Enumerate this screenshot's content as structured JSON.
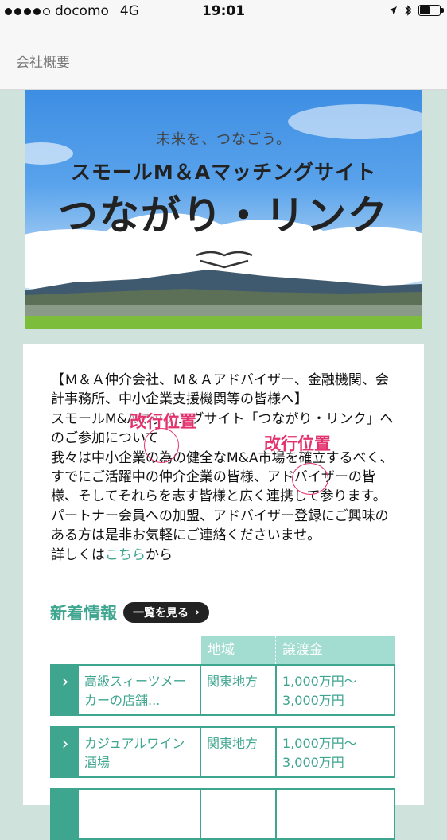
{
  "status_bar": {
    "carrier": "docomo",
    "network": "4G",
    "time": "19:01"
  },
  "header": {
    "title": "会社概要"
  },
  "banner": {
    "tagline": "未来を、つなごう。",
    "subtitle": "スモールM＆Aマッチングサイト",
    "brand": "つながり・リンク"
  },
  "intro": {
    "line1": "【Ｍ＆Ａ仲介会社、Ｍ＆Ａアドバイザー、金融機関、会計事務所、中小企業支援機関等の皆様へ】",
    "line2": "スモールM&Aマッチングサイト「つながり・リンク」へのご参加について",
    "line3": "我々は中小企業の為の健全なM&A市場を確立するべく、すでにご活躍中の仲介企業の皆様、アドバイザーの皆様、そしてそれらを志す皆様と広く連携して参ります。",
    "line4": "パートナー会員への加盟、アドバイザー登録にご興味のある方は是非お気軽にご連絡くださいませ。",
    "more_prefix": "詳しくは",
    "more_link": "こちら",
    "more_suffix": "から"
  },
  "annotations": {
    "label_1": "改行位置",
    "label_2": "改行位置"
  },
  "news": {
    "title": "新着情報",
    "see_all": "一覧を見る",
    "columns": {
      "region": "地域",
      "price": "譲渡金"
    },
    "rows": [
      {
        "name": "高級スィーツメーカーの店舗...",
        "region": "関東地方",
        "price": "1,000万円〜3,000万円"
      },
      {
        "name": "カジュアルワイン酒場",
        "region": "関東地方",
        "price": "1,000万円〜3,000万円"
      },
      {
        "name": "",
        "region": "",
        "price": ""
      }
    ]
  },
  "colors": {
    "accent": "#3ea58f",
    "annotation": "#e2336e",
    "background": "#cfe3dc",
    "table_header": "#a3ddd1"
  }
}
